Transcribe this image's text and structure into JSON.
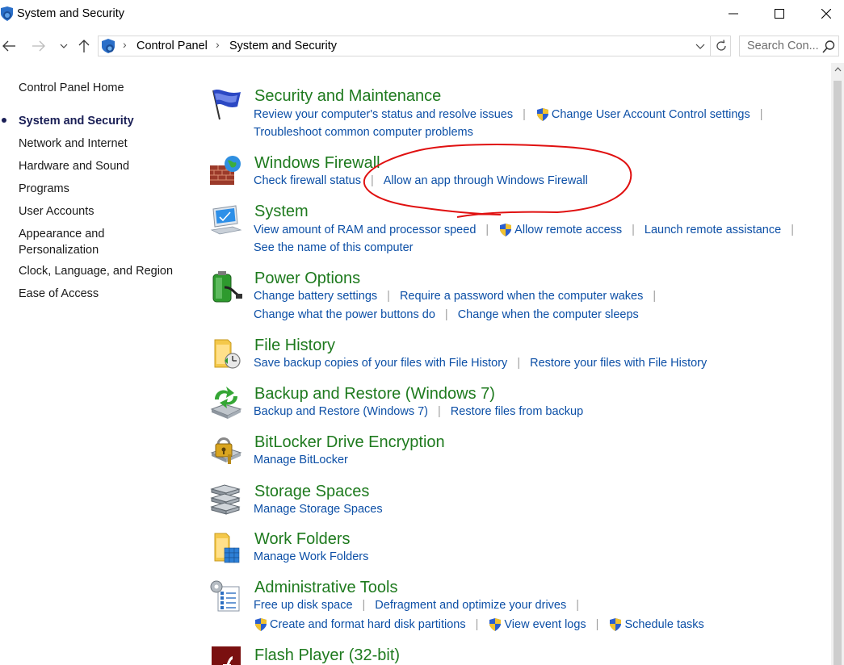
{
  "window": {
    "title": "System and Security"
  },
  "address": {
    "crumbs": [
      "Control Panel",
      "System and Security"
    ]
  },
  "search": {
    "placeholder": "Search Con..."
  },
  "leftnav": {
    "items": [
      {
        "label": "Control Panel Home"
      },
      {
        "label": "System and Security"
      },
      {
        "label": "Network and Internet"
      },
      {
        "label": "Hardware and Sound"
      },
      {
        "label": "Programs"
      },
      {
        "label": "User Accounts"
      },
      {
        "label": "Appearance and"
      },
      {
        "label": "Personalization"
      },
      {
        "label": "Clock, Language, and Region"
      },
      {
        "label": "Ease of Access"
      }
    ]
  },
  "categories": [
    {
      "title": "Security and Maintenance",
      "links": [
        "Review your computer's status and resolve issues",
        "Change User Account Control settings",
        "Troubleshoot common computer problems"
      ]
    },
    {
      "title": "Windows Firewall",
      "links": [
        "Check firewall status",
        "Allow an app through Windows Firewall"
      ]
    },
    {
      "title": "System",
      "links": [
        "View amount of RAM and processor speed",
        "Allow remote access",
        "Launch remote assistance",
        "See the name of this computer"
      ]
    },
    {
      "title": "Power Options",
      "links": [
        "Change battery settings",
        "Require a password when the computer wakes",
        "Change what the power buttons do",
        "Change when the computer sleeps"
      ]
    },
    {
      "title": "File History",
      "links": [
        "Save backup copies of your files with File History",
        "Restore your files with File History"
      ]
    },
    {
      "title": "Backup and Restore (Windows 7)",
      "links": [
        "Backup and Restore (Windows 7)",
        "Restore files from backup"
      ]
    },
    {
      "title": "BitLocker Drive Encryption",
      "links": [
        "Manage BitLocker"
      ]
    },
    {
      "title": "Storage Spaces",
      "links": [
        "Manage Storage Spaces"
      ]
    },
    {
      "title": "Work Folders",
      "links": [
        "Manage Work Folders"
      ]
    },
    {
      "title": "Administrative Tools",
      "links": [
        "Free up disk space",
        "Defragment and optimize your drives",
        "Create and format hard disk partitions",
        "View event logs",
        "Schedule tasks"
      ]
    },
    {
      "title": "Flash Player (32-bit)",
      "links": []
    }
  ],
  "colors": {
    "link": "#0c4fa6",
    "category_title": "#1e7a1e",
    "active_nav": "#1a1f56",
    "annotation": "#e01010"
  },
  "icons": {
    "app": "control-panel-shield-icon",
    "uac": "uac-shield-icon"
  }
}
